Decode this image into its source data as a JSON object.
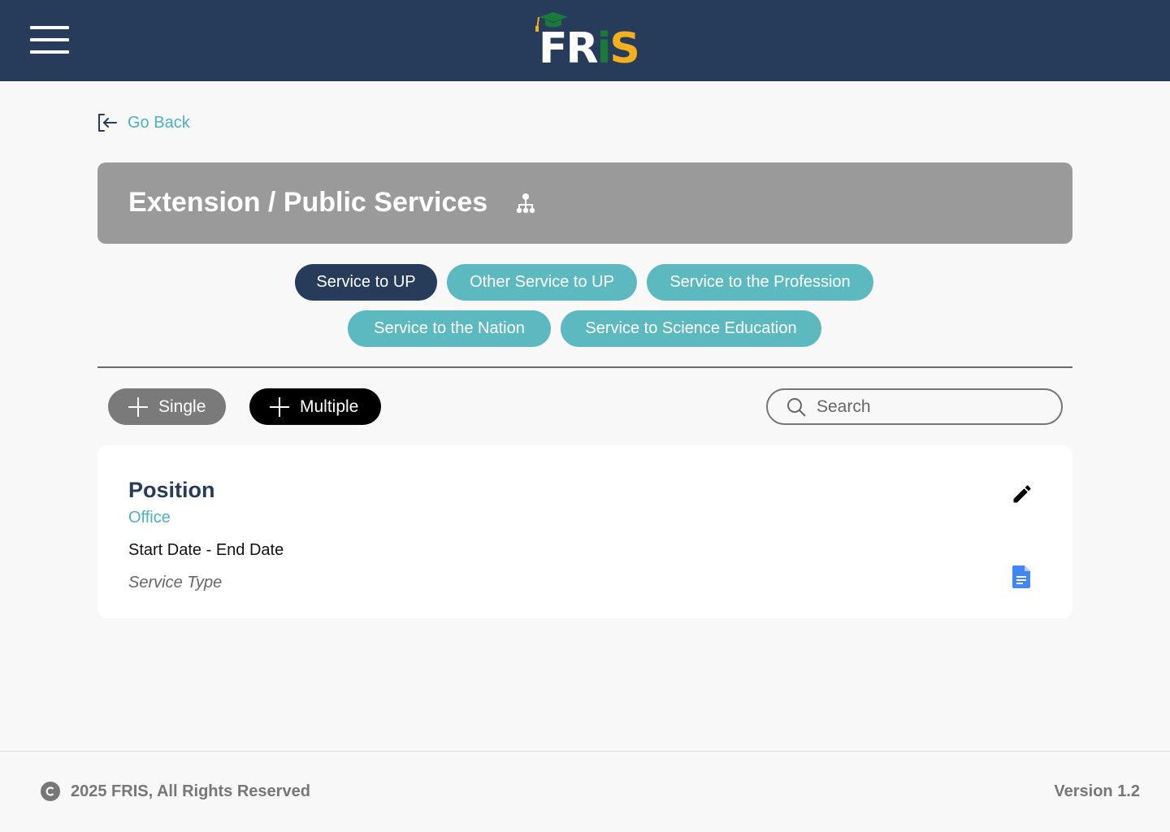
{
  "header": {
    "logo_text_parts": [
      "FR",
      "i",
      "S"
    ],
    "logo_colors": {
      "white": "#ffffff",
      "green": "#1a7a3a",
      "yellow": "#f2b01e"
    },
    "bar_color": "#273b5b",
    "menu_icon": "hamburger-menu-icon"
  },
  "nav": {
    "go_back_label": "Go Back",
    "go_back_icon": "exit-arrow-icon"
  },
  "section": {
    "title": "Extension / Public Services",
    "icon": "org-chart-icon"
  },
  "tabs": [
    {
      "label": "Service to UP",
      "active": true
    },
    {
      "label": "Other Service to UP",
      "active": false
    },
    {
      "label": "Service to the Profession",
      "active": false
    },
    {
      "label": "Service to the Nation",
      "active": false
    },
    {
      "label": "Service to Science Education",
      "active": false
    }
  ],
  "toolbar": {
    "single_label": "Single",
    "multiple_label": "Multiple",
    "search_placeholder": "Search",
    "search_value": ""
  },
  "card": {
    "title": "Position",
    "office": "Office",
    "dates": "Start Date - End Date",
    "service_type": "Service Type",
    "edit_icon": "pencil-icon",
    "doc_icon": "document-icon"
  },
  "footer": {
    "copyright": "2025 FRIS, All Rights Reserved",
    "version": "Version 1.2"
  },
  "colors": {
    "navy": "#273b5b",
    "teal": "#5cb9bf",
    "link_teal": "#4ab3bd",
    "header_grey": "#9a9a9a",
    "doc_blue": "#4285f4"
  }
}
